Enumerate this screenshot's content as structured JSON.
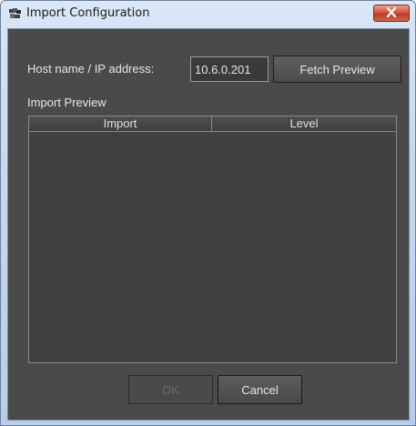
{
  "window": {
    "title": "Import Configuration",
    "icon": "app-icon",
    "close_icon": "close-icon"
  },
  "form": {
    "host_label": "Host name / IP address:",
    "host_value": "10.6.0.201",
    "fetch_label": "Fetch Preview"
  },
  "preview": {
    "label": "Import Preview",
    "columns": [
      "Import",
      "Level"
    ],
    "rows": []
  },
  "buttons": {
    "ok_label": "OK",
    "cancel_label": "Cancel",
    "ok_enabled": false
  },
  "colors": {
    "panel_bg": "#4a4a4a",
    "text": "#e6e6e6",
    "close_red": "#c23a22"
  }
}
